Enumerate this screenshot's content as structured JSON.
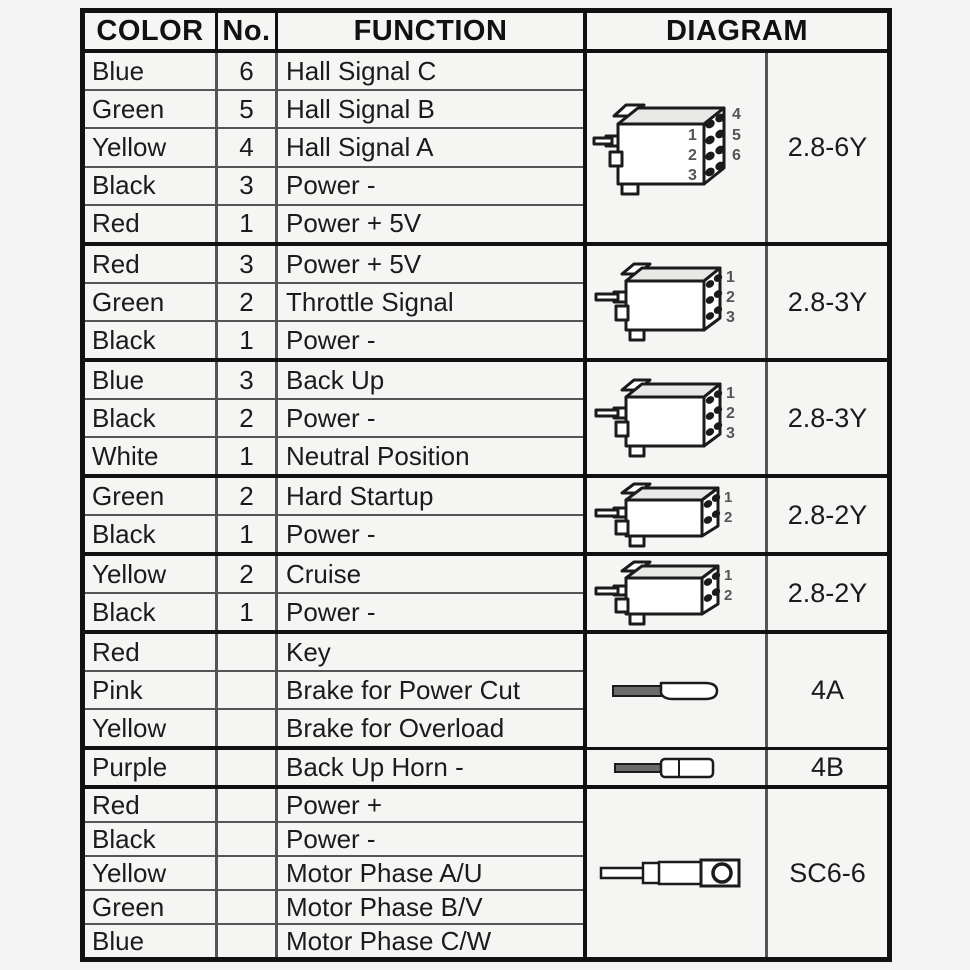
{
  "table": {
    "headers": {
      "color": "COLOR",
      "number": "No.",
      "function": "FUNCTION",
      "diagram": "DIAGRAM"
    },
    "groups": [
      {
        "connector": {
          "code": "2.8-6Y",
          "type": "6-pin-housing",
          "pins": [
            "1",
            "2",
            "3",
            "4",
            "5",
            "6"
          ]
        },
        "rows": [
          {
            "color": "Blue",
            "no": "6",
            "function": "Hall Signal C"
          },
          {
            "color": "Green",
            "no": "5",
            "function": "Hall Signal B"
          },
          {
            "color": "Yellow",
            "no": "4",
            "function": "Hall Signal A"
          },
          {
            "color": "Black",
            "no": "3",
            "function": "Power -"
          },
          {
            "color": "Red",
            "no": "1",
            "function": "Power + 5V"
          }
        ]
      },
      {
        "connector": {
          "code": "2.8-3Y",
          "type": "3-pin-housing",
          "pins": [
            "1",
            "2",
            "3"
          ]
        },
        "rows": [
          {
            "color": "Red",
            "no": "3",
            "function": "Power + 5V"
          },
          {
            "color": "Green",
            "no": "2",
            "function": "Throttle Signal"
          },
          {
            "color": "Black",
            "no": "1",
            "function": "Power -"
          }
        ]
      },
      {
        "connector": {
          "code": "2.8-3Y",
          "type": "3-pin-housing",
          "pins": [
            "1",
            "2",
            "3"
          ]
        },
        "rows": [
          {
            "color": "Blue",
            "no": "3",
            "function": "Back Up"
          },
          {
            "color": "Black",
            "no": "2",
            "function": "Power -"
          },
          {
            "color": "White",
            "no": "1",
            "function": "Neutral Position"
          }
        ]
      },
      {
        "connector": {
          "code": "2.8-2Y",
          "type": "2-pin-housing",
          "pins": [
            "1",
            "2"
          ]
        },
        "rows": [
          {
            "color": "Green",
            "no": "2",
            "function": "Hard Startup"
          },
          {
            "color": "Black",
            "no": "1",
            "function": "Power -"
          }
        ]
      },
      {
        "connector": {
          "code": "2.8-2Y",
          "type": "2-pin-housing",
          "pins": [
            "1",
            "2"
          ]
        },
        "rows": [
          {
            "color": "Yellow",
            "no": "2",
            "function": "Cruise"
          },
          {
            "color": "Black",
            "no": "1",
            "function": "Power -"
          }
        ]
      },
      {
        "connector": {
          "code": "4A",
          "type": "flat-spade-terminal",
          "pins": []
        },
        "rows": [
          {
            "color": "Red",
            "no": "",
            "function": "Key"
          },
          {
            "color": "Pink",
            "no": "",
            "function": "Brake for Power Cut"
          },
          {
            "color": "Yellow",
            "no": "",
            "function": "Brake for Overload"
          }
        ]
      },
      {
        "connector": {
          "code": "4B",
          "type": "bullet-terminal",
          "pins": []
        },
        "rows": [
          {
            "color": "Purple",
            "no": "",
            "function": "Back Up Horn -"
          }
        ]
      },
      {
        "connector": {
          "code": "SC6-6",
          "type": "ring-terminal",
          "pins": []
        },
        "rows": [
          {
            "color": "Red",
            "no": "",
            "function": "Power +"
          },
          {
            "color": "Black",
            "no": "",
            "function": "Power -"
          },
          {
            "color": "Yellow",
            "no": "",
            "function": "Motor Phase A/U"
          },
          {
            "color": "Green",
            "no": "",
            "function": "Motor Phase B/V"
          },
          {
            "color": "Blue",
            "no": "",
            "function": "Motor Phase C/W"
          }
        ]
      }
    ]
  },
  "colors": {
    "page_background": "#f3f3f3",
    "table_background": "#f5f5f3",
    "border_heavy": "#111111",
    "border_light": "#555555",
    "text": "#1b1b1b"
  }
}
